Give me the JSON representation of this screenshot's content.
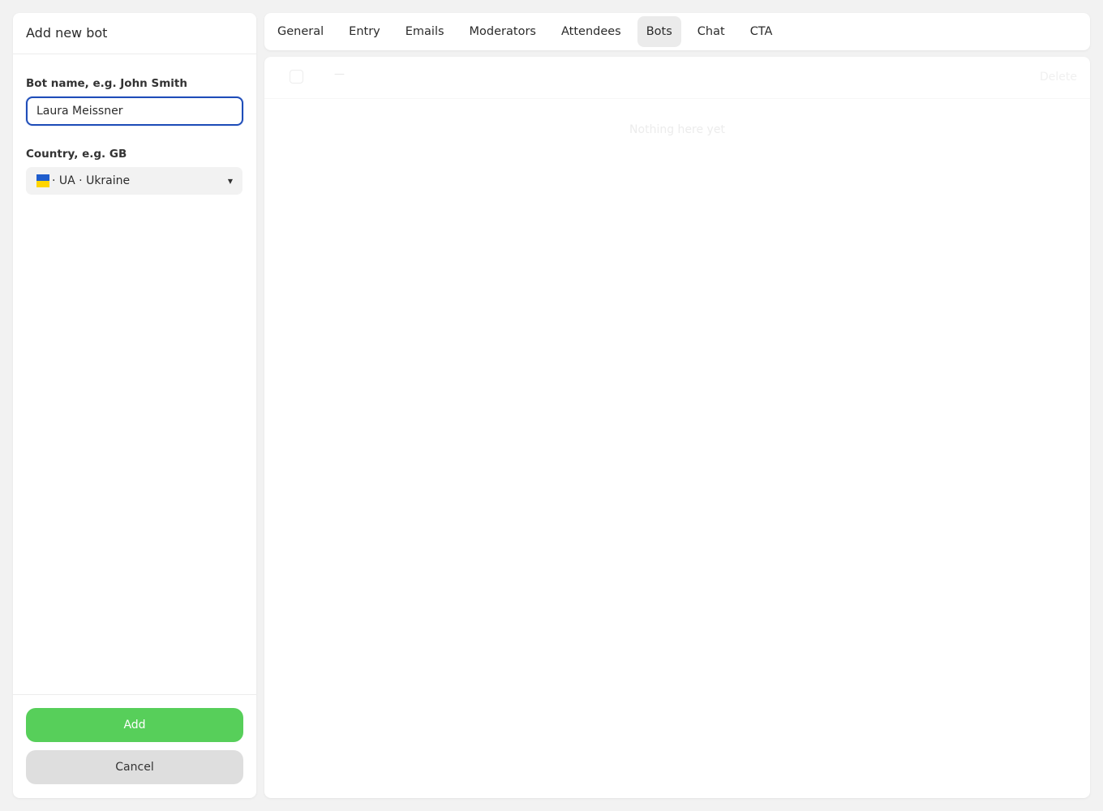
{
  "sidebar": {
    "title": "Add new bot",
    "name_label": "Bot name, e.g. John Smith",
    "name_value": "Laura Meissner",
    "country_label": "Country, e.g. GB",
    "country_value": "· UA · Ukraine",
    "flag_colors": [
      "#1f5dcc",
      "#ffd500"
    ],
    "add_label": "Add",
    "cancel_label": "Cancel"
  },
  "tabs": [
    {
      "label": "General"
    },
    {
      "label": "Entry"
    },
    {
      "label": "Emails"
    },
    {
      "label": "Moderators"
    },
    {
      "label": "Attendees"
    },
    {
      "label": "Bots",
      "active": true
    },
    {
      "label": "Chat"
    },
    {
      "label": "CTA"
    }
  ],
  "list": {
    "dash": "—",
    "delete_label": "Delete",
    "empty_text": "Nothing here yet"
  },
  "colors": {
    "accent_green": "#57cf5a",
    "focus_blue": "#1f4db8"
  }
}
